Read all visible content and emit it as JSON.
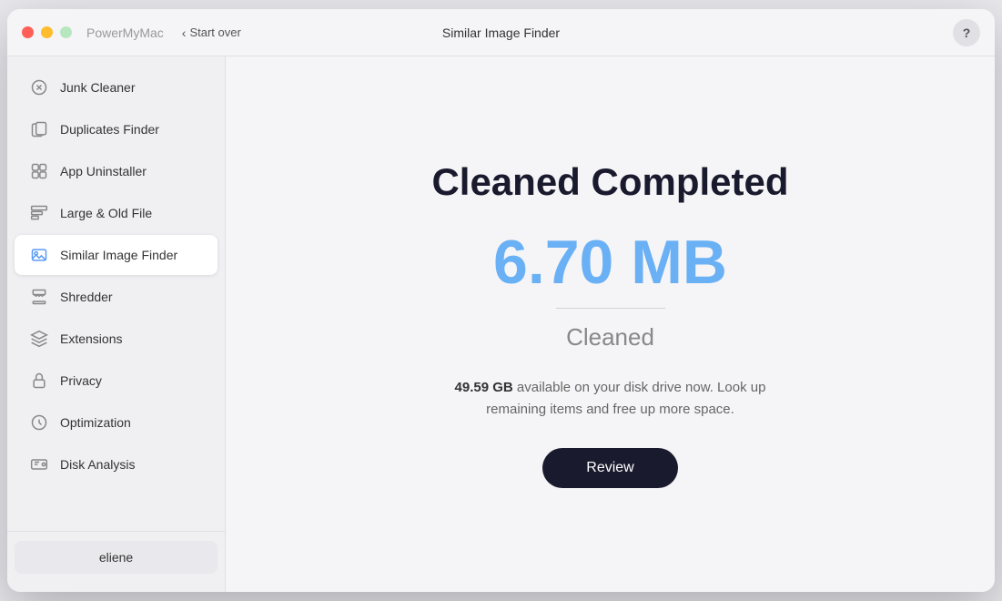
{
  "window": {
    "app_name": "PowerMyMac",
    "start_over_label": "Start over",
    "title": "Similar Image Finder",
    "help_label": "?"
  },
  "sidebar": {
    "items": [
      {
        "id": "junk-cleaner",
        "label": "Junk Cleaner",
        "icon": "junk"
      },
      {
        "id": "duplicates-finder",
        "label": "Duplicates Finder",
        "icon": "duplicates"
      },
      {
        "id": "app-uninstaller",
        "label": "App Uninstaller",
        "icon": "uninstaller"
      },
      {
        "id": "large-old-file",
        "label": "Large & Old File",
        "icon": "large"
      },
      {
        "id": "similar-image-finder",
        "label": "Similar Image Finder",
        "icon": "image",
        "active": true
      },
      {
        "id": "shredder",
        "label": "Shredder",
        "icon": "shredder"
      },
      {
        "id": "extensions",
        "label": "Extensions",
        "icon": "extensions"
      },
      {
        "id": "privacy",
        "label": "Privacy",
        "icon": "privacy"
      },
      {
        "id": "optimization",
        "label": "Optimization",
        "icon": "optimization"
      },
      {
        "id": "disk-analysis",
        "label": "Disk Analysis",
        "icon": "disk"
      }
    ],
    "user": "eliene"
  },
  "content": {
    "headline": "Cleaned Completed",
    "size": "6.70 MB",
    "size_label": "Cleaned",
    "disk_size": "49.59 GB",
    "disk_message": " available on your disk drive now. Look up remaining items and free up more space.",
    "review_button": "Review"
  }
}
